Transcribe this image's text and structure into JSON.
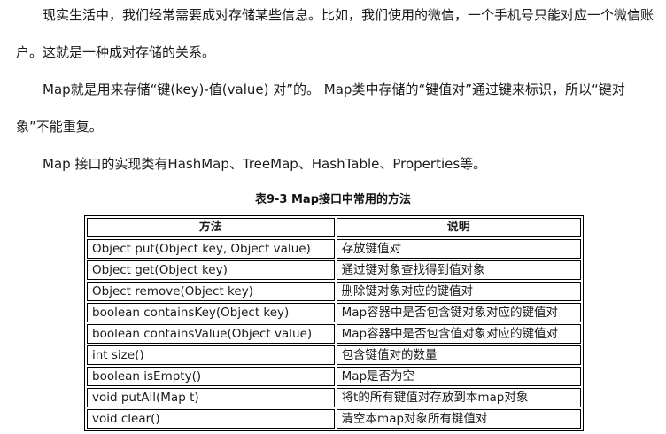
{
  "paragraphs": [
    "现实生活中，我们经常需要成对存储某些信息。比如，我们使用的微信，一个手机号只能对应一个微信账户。这就是一种成对存储的关系。",
    "Map就是用来存储“键(key)-值(value) 对”的。 Map类中存储的“键值对”通过键来标识，所以“键对象”不能重复。",
    "Map 接口的实现类有HashMap、TreeMap、HashTable、Properties等。"
  ],
  "table": {
    "caption": "表9-3 Map接口中常用的方法",
    "headers": [
      "方法",
      "说明"
    ],
    "rows": [
      [
        "Object put(Object key, Object value)",
        "存放键值对"
      ],
      [
        "Object get(Object key)",
        "通过键对象查找得到值对象"
      ],
      [
        "Object remove(Object key)",
        "删除键对象对应的键值对"
      ],
      [
        "boolean containsKey(Object key)",
        "Map容器中是否包含键对象对应的键值对"
      ],
      [
        "boolean containsValue(Object value)",
        "Map容器中是否包含值对象对应的键值对"
      ],
      [
        "int size()",
        "包含键值对的数量"
      ],
      [
        "boolean isEmpty()",
        "Map是否为空"
      ],
      [
        "void putAll(Map t)",
        "将t的所有键值对存放到本map对象"
      ],
      [
        "void clear()",
        "清空本map对象所有键值对"
      ]
    ]
  }
}
